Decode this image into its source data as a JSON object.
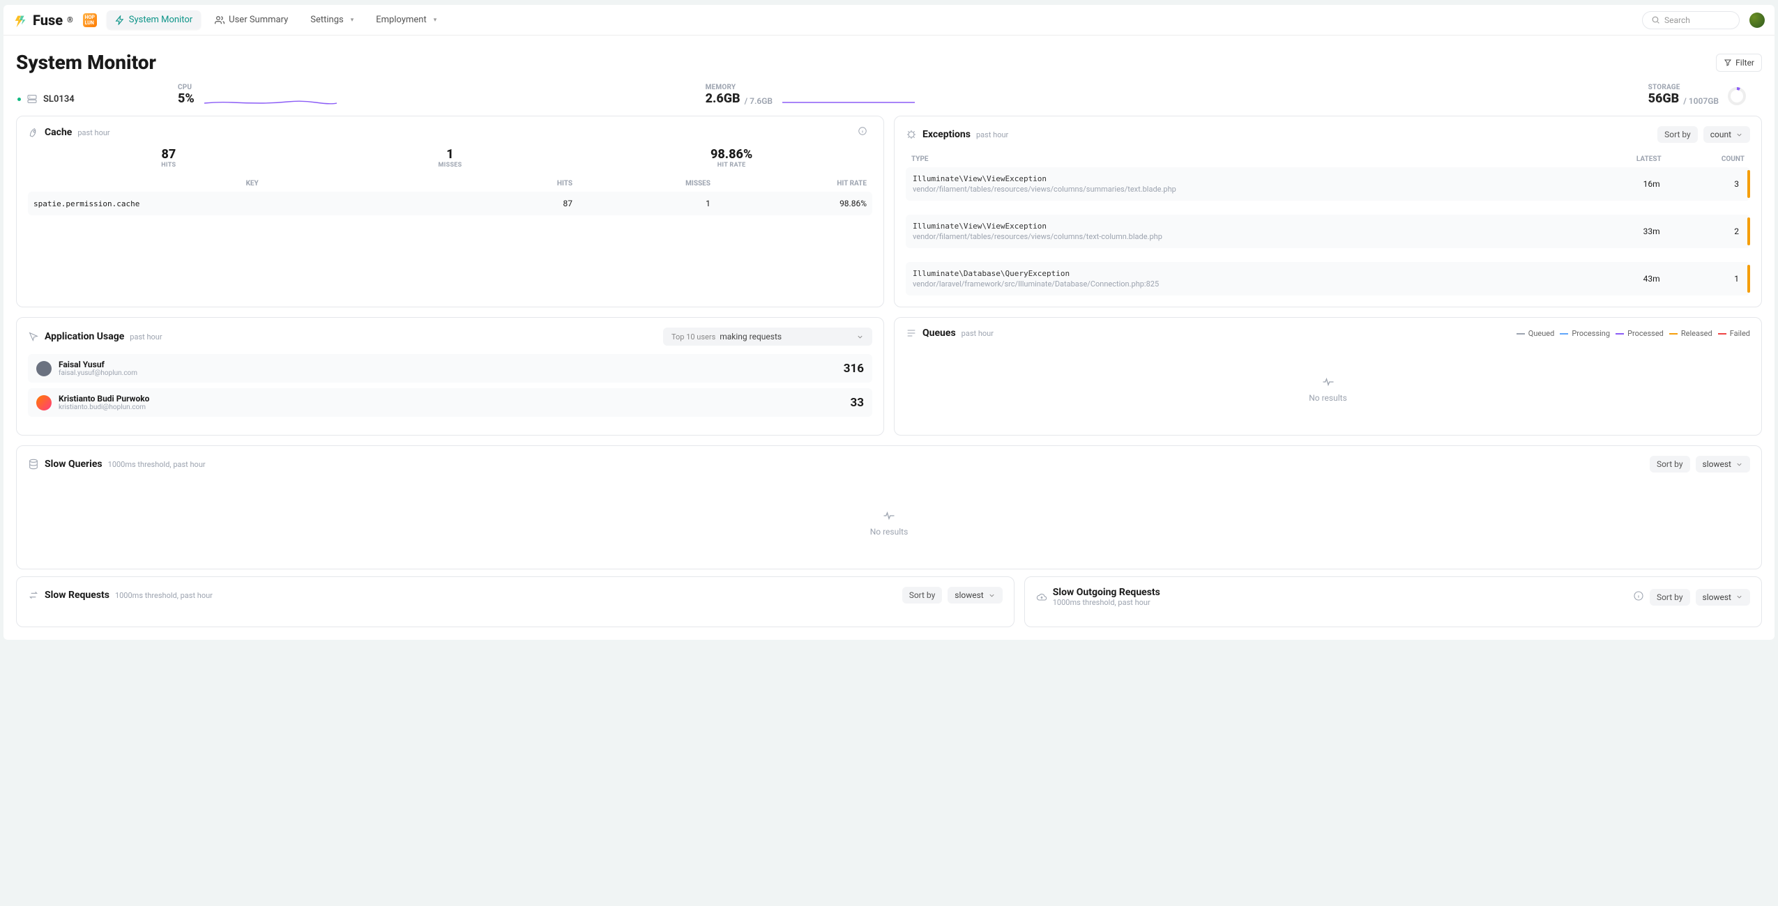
{
  "nav": {
    "brand": "Fuse",
    "items": [
      {
        "label": "System Monitor",
        "active": true
      },
      {
        "label": "User Summary",
        "active": false
      },
      {
        "label": "Settings",
        "active": false,
        "dropdown": true
      },
      {
        "label": "Employment",
        "active": false,
        "dropdown": true
      }
    ],
    "search_placeholder": "Search"
  },
  "page": {
    "title": "System Monitor",
    "filter_label": "Filter"
  },
  "server": {
    "name": "SL0134",
    "cpu": {
      "label": "CPU",
      "value": "5%"
    },
    "memory": {
      "label": "MEMORY",
      "value": "2.6GB",
      "total": "/ 7.6GB"
    },
    "storage": {
      "label": "STORAGE",
      "value": "56GB",
      "total": "/ 1007GB"
    }
  },
  "cache": {
    "title": "Cache",
    "period": "past hour",
    "hits": {
      "value": "87",
      "label": "HITS"
    },
    "misses": {
      "value": "1",
      "label": "MISSES"
    },
    "hit_rate": {
      "value": "98.86%",
      "label": "HIT RATE"
    },
    "columns": [
      "KEY",
      "HITS",
      "MISSES",
      "HIT RATE"
    ],
    "rows": [
      {
        "key": "spatie.permission.cache",
        "hits": "87",
        "misses": "1",
        "rate": "98.86%"
      }
    ]
  },
  "exceptions": {
    "title": "Exceptions",
    "period": "past hour",
    "sort_label": "Sort by",
    "sort_value": "count",
    "columns": [
      "TYPE",
      "LATEST",
      "COUNT"
    ],
    "rows": [
      {
        "type": "Illuminate\\View\\ViewException",
        "path": "vendor/filament/tables/resources/views/columns/summaries/text.blade.php",
        "latest": "16m",
        "count": "3"
      },
      {
        "type": "Illuminate\\View\\ViewException",
        "path": "vendor/filament/tables/resources/views/columns/text-column.blade.php",
        "latest": "33m",
        "count": "2"
      },
      {
        "type": "Illuminate\\Database\\QueryException",
        "path": "vendor/laravel/framework/src/Illuminate/Database/Connection.php:825",
        "latest": "43m",
        "count": "1"
      }
    ]
  },
  "usage": {
    "title": "Application Usage",
    "period": "past hour",
    "filter_hint": "Top 10 users",
    "filter_value": "making requests",
    "users": [
      {
        "name": "Faisal Yusuf",
        "email": "faisal.yusuf@hoplun.com",
        "count": "316"
      },
      {
        "name": "Kristianto Budi Purwoko",
        "email": "kristianto.budi@hoplun.com",
        "count": "33"
      }
    ]
  },
  "queues": {
    "title": "Queues",
    "period": "past hour",
    "legend": [
      "Queued",
      "Processing",
      "Processed",
      "Released",
      "Failed"
    ],
    "empty": "No results"
  },
  "slow_queries": {
    "title": "Slow Queries",
    "sub": "1000ms threshold, past hour",
    "sort_label": "Sort by",
    "sort_value": "slowest",
    "empty": "No results"
  },
  "slow_requests": {
    "title": "Slow Requests",
    "sub": "1000ms threshold, past hour",
    "sort_label": "Sort by",
    "sort_value": "slowest"
  },
  "slow_outgoing": {
    "title": "Slow Outgoing Requests",
    "sub": "1000ms threshold, past hour",
    "sort_label": "Sort by",
    "sort_value": "slowest"
  }
}
